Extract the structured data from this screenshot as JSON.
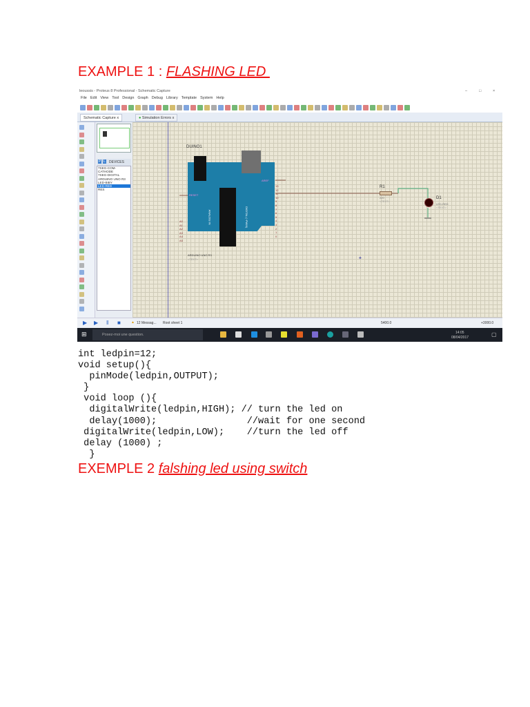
{
  "heading1": {
    "prefix": "EXAMPLE 1 : ",
    "title": "FLASHING LED "
  },
  "screenshot": {
    "window_title": "leoussis - Proteus 8 Professional - Schematic Capture",
    "menu": [
      "File",
      "Edit",
      "View",
      "Tool",
      "Design",
      "Graph",
      "Debug",
      "Library",
      "Template",
      "System",
      "Help"
    ],
    "tabs": [
      {
        "label": "Schematic Capture",
        "close": "x"
      },
      {
        "label": "Simulation Errors",
        "close": "x"
      }
    ],
    "devices_header": "DEVICES",
    "devices_modes": [
      "P",
      "L"
    ],
    "devices": [
      "7SEG-COM-CATHODE",
      "7SEG-DIGITAL",
      "ARDUINO UNO R3",
      "LED-BIBY",
      "LED-RED",
      "RES"
    ],
    "selected_device": "LED-RED",
    "schematic": {
      "board_ref": "DUINO1",
      "board_name": "ARDUINO UNO R3",
      "board_text": "<TEXT>",
      "reset": "RESET",
      "aref": "AREF",
      "analog_label": "ANALOG IN",
      "digital_label": "DIGITAL (~PWM)",
      "resistor_ref": "R1",
      "resistor_value": "220",
      "resistor_text": "<TEXT>",
      "led_ref": "D1",
      "led_value": "LED-RED",
      "led_text": "<TEXT>",
      "analog_pins": [
        "A0",
        "A1",
        "A2",
        "A3",
        "A4",
        "A5"
      ],
      "digital_pins": [
        "13",
        "12",
        "11",
        "10",
        "9",
        "8",
        "7",
        "6",
        "5",
        "4",
        "3",
        "2",
        "1",
        "0"
      ]
    },
    "status": {
      "messages": "12 Messag...",
      "sheet": "Root sheet 1",
      "x": "5400.0",
      "y": "+3000.0"
    },
    "taskbar": {
      "search_placeholder": "Posez-moi une question.",
      "time": "14:05",
      "date": "08/04/2017"
    }
  },
  "code": "int ledpin=12;\nvoid setup(){\n  pinMode(ledpin,OUTPUT);\n }\n void loop (){\n  digitalWrite(ledpin,HIGH); // turn the led on\n  delay(1000);                //wait for one second\n digitalWrite(ledpin,LOW);    //turn the led off\n delay (1000) ;\n  }",
  "heading2": {
    "prefix": "EXEMPLE 2 ",
    "title": "falshing led using switch"
  }
}
